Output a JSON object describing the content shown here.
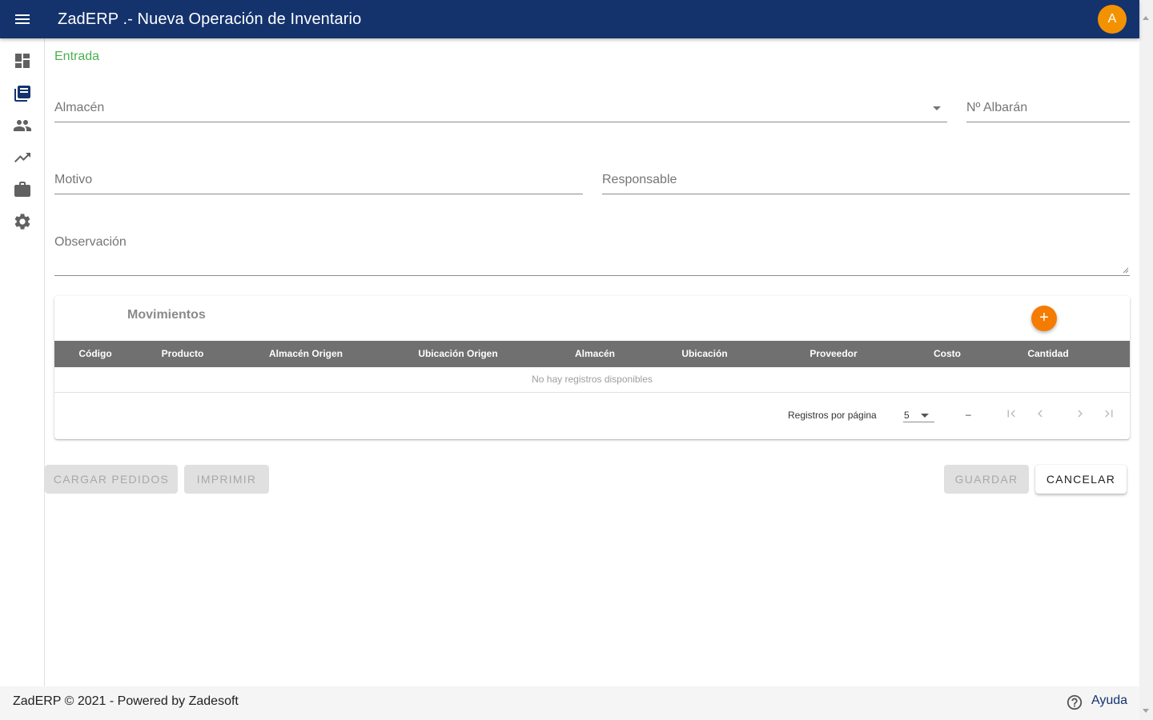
{
  "app": {
    "title": "ZadERP .- Nueva Operación de Inventario",
    "avatar_initial": "A",
    "brand_color": "#14336d",
    "accent_color": "#f39200"
  },
  "sidebar": {
    "items": [
      {
        "icon": "dashboard-icon"
      },
      {
        "icon": "library-books-icon"
      },
      {
        "icon": "people-icon"
      },
      {
        "icon": "trending-up-icon"
      },
      {
        "icon": "briefcase-icon"
      },
      {
        "icon": "settings-icon"
      }
    ]
  },
  "form": {
    "operation_type": "Entrada",
    "almacen_label": "Almacén",
    "albaran_label": "Nº Albarán",
    "motivo_label": "Motivo",
    "responsable_label": "Responsable",
    "observacion_label": "Observación"
  },
  "movimientos": {
    "title": "Movimientos",
    "add_icon": "plus-icon",
    "columns": [
      "Código",
      "Producto",
      "Almacén Origen",
      "Ubicación Origen",
      "Almacén",
      "Ubicación",
      "Proveedor",
      "Costo",
      "Cantidad"
    ],
    "empty_text": "No hay registros disponibles",
    "pagination": {
      "rows_per_page_label": "Registros por página",
      "rows_per_page_value": "5",
      "range_text": "–"
    }
  },
  "actions": {
    "cargar_pedidos": "CARGAR PEDIDOS",
    "imprimir": "IMPRIMIR",
    "guardar": "GUARDAR",
    "cancelar": "CANCELAR"
  },
  "footer": {
    "copyright": "ZadERP © 2021 - Powered by Zadesoft",
    "help_label": "Ayuda"
  }
}
